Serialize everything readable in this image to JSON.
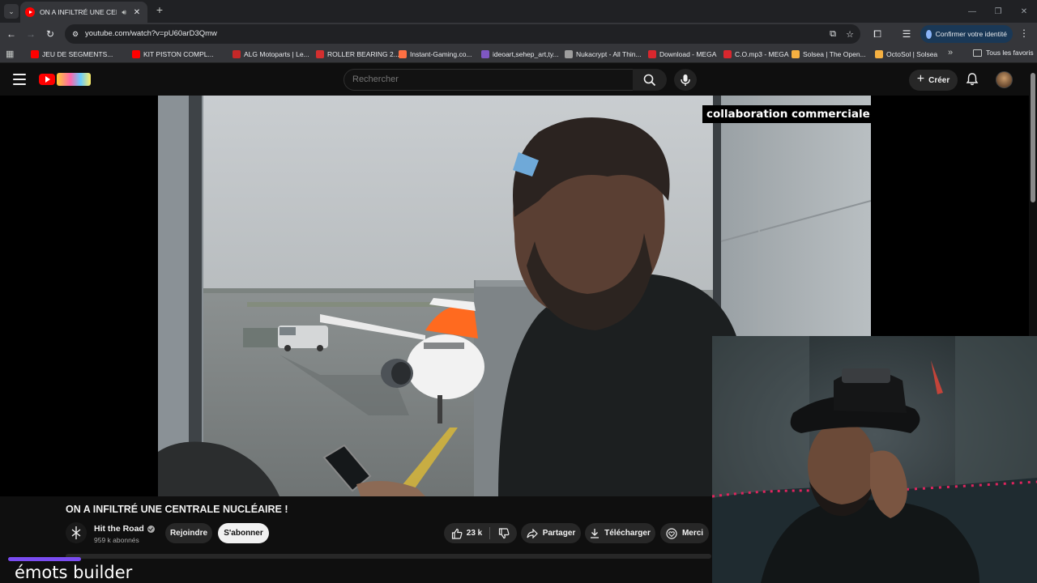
{
  "browser": {
    "tab": {
      "title": "ON A INFILTRÉ UNE CENTR",
      "favicon": "youtube-favicon-icon",
      "audio_icon": "speaker-icon"
    },
    "url": "youtube.com/watch?v=pU60arD3Qmw",
    "profile_button": "Confirmer votre identité",
    "bookmarks": [
      {
        "label": "JEU DE SEGMENTS...",
        "icon_color": "#ff0000"
      },
      {
        "label": "KIT PISTON COMPL...",
        "icon_color": "#ff0000"
      },
      {
        "label": "ALG Motoparts | Le...",
        "icon_color": "#c62828"
      },
      {
        "label": "ROLLER BEARING 2...",
        "icon_color": "#d32f2f"
      },
      {
        "label": "Instant-Gaming.co...",
        "icon_color": "#ff7043"
      },
      {
        "label": "ideoart,sehep_art,ty...",
        "icon_color": "#7e57c2"
      },
      {
        "label": "Nukacrypt - All Thin...",
        "icon_color": "#9e9e9e"
      },
      {
        "label": "Download - MEGA",
        "icon_color": "#d9272e"
      },
      {
        "label": "C.O.mp3 - MEGA",
        "icon_color": "#d9272e"
      },
      {
        "label": "Solsea | The Open...",
        "icon_color": "#f5b041"
      },
      {
        "label": "OctoSol | Solsea",
        "icon_color": "#f5b041"
      }
    ],
    "all_bookmarks": "Tous les favoris"
  },
  "youtube": {
    "search_placeholder": "Rechercher",
    "create_label": "Créer",
    "video": {
      "sponsor_label": "collaboration commerciale",
      "title": "ON A INFILTRÉ UNE CENTRALE NUCLÉAIRE !",
      "channel": "Hit the Road",
      "subscribers": "959 k abonnés",
      "join_label": "Rejoindre",
      "subscribe_label": "S'abonner",
      "likes": "23 k",
      "share_label": "Partager",
      "download_label": "Télécharger",
      "thanks_label": "Merci"
    }
  },
  "overlay": {
    "chat_text": "émots builder"
  },
  "colors": {
    "yt_red": "#ff0000",
    "background": "#0f0f0f",
    "button_bg": "#272727",
    "overlay_accent": "#7a4cf0"
  }
}
